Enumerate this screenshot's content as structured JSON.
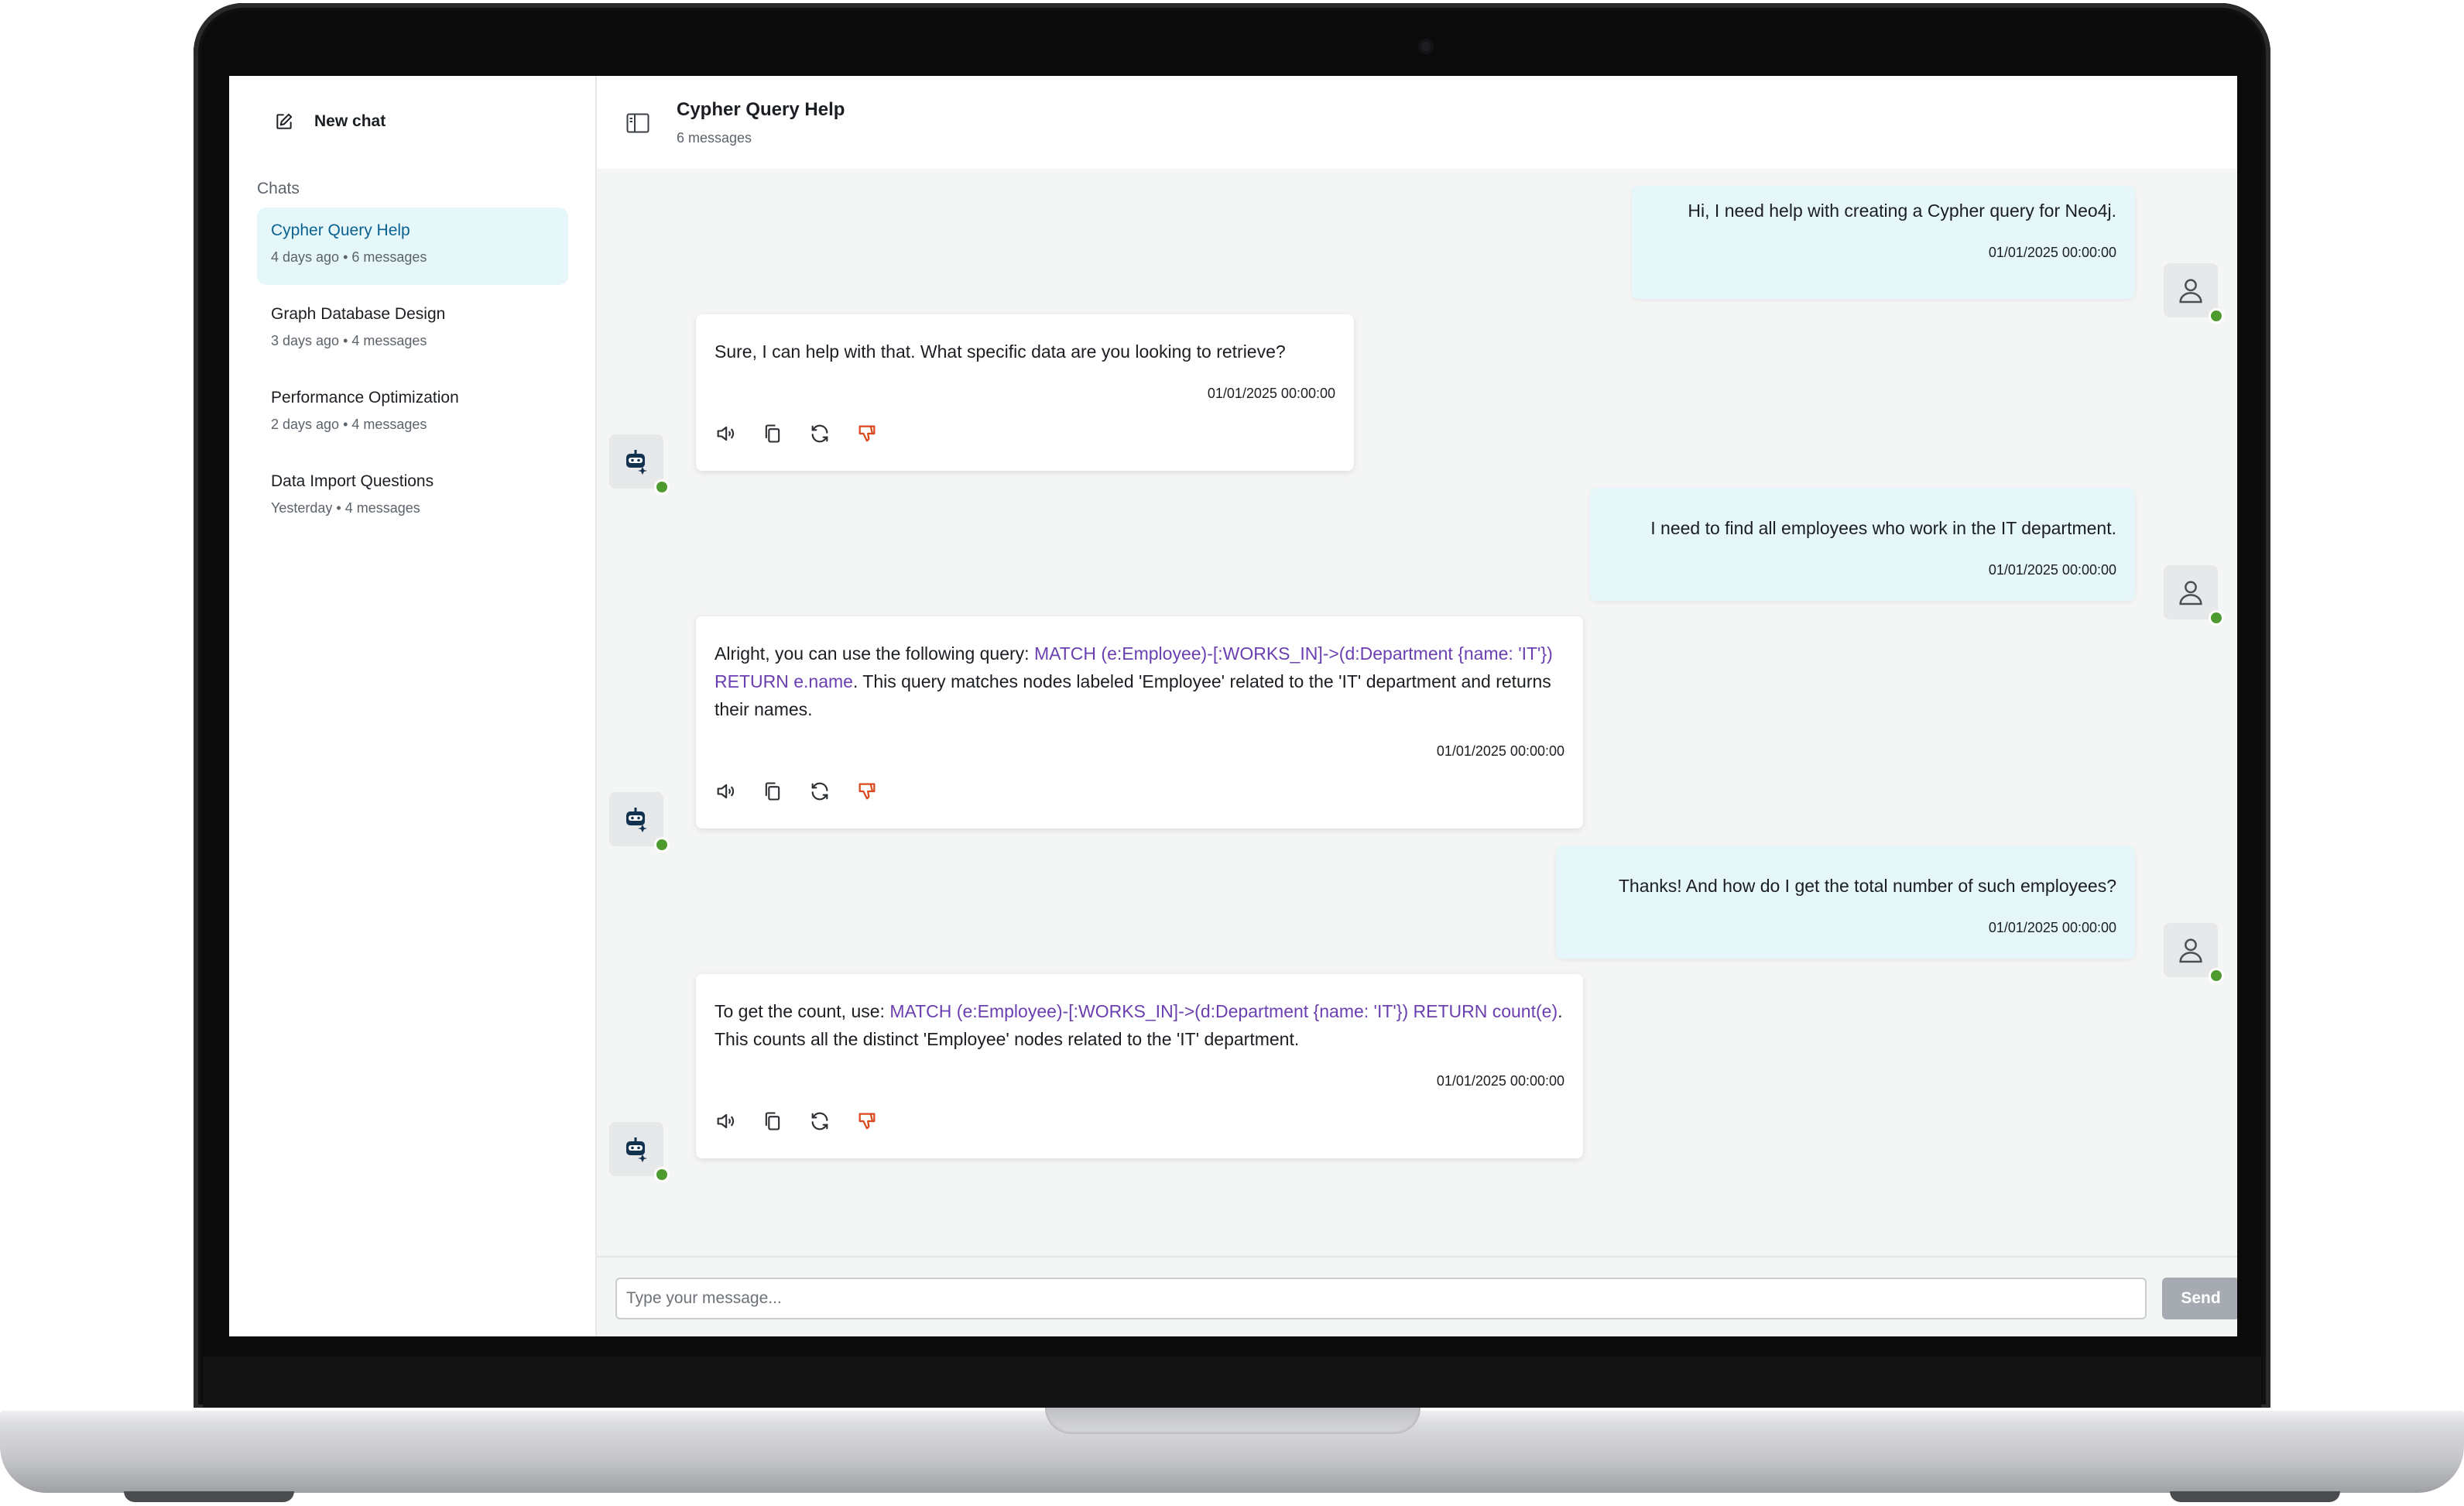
{
  "sidebar": {
    "new_chat_label": "New chat",
    "chats_heading": "Chats",
    "items": [
      {
        "title": "Cypher Query Help",
        "meta": "4 days ago • 6 messages"
      },
      {
        "title": "Graph Database Design",
        "meta": "3 days ago • 4 messages"
      },
      {
        "title": "Performance Optimization",
        "meta": "2 days ago • 4 messages"
      },
      {
        "title": "Data Import Questions",
        "meta": "Yesterday • 4 messages"
      }
    ]
  },
  "header": {
    "title": "Cypher Query Help",
    "subtitle": "6 messages"
  },
  "messages": [
    {
      "role": "user",
      "text": "Hi, I need help with creating a Cypher query for Neo4j.",
      "time": "01/01/2025 00:00:00"
    },
    {
      "role": "bot",
      "text": "Sure, I can help with that. What specific data are you looking to retrieve?",
      "time": "01/01/2025 00:00:00"
    },
    {
      "role": "user",
      "text": "I need to find all employees who work in the IT department.",
      "time": "01/01/2025 00:00:00"
    },
    {
      "role": "bot",
      "text_before": "Alright, you can use the following query: ",
      "code": "MATCH (e:Employee)-[:WORKS_IN]->(d:Department {name: 'IT'}) RETURN e.name",
      "text_after": ". This query matches nodes labeled 'Employee' related to the 'IT' department and returns their names.",
      "time": "01/01/2025 00:00:00"
    },
    {
      "role": "user",
      "text": "Thanks! And how do I get the total number of such employees?",
      "time": "01/01/2025 00:00:00"
    },
    {
      "role": "bot",
      "text_before": "To get the count, use: ",
      "code": "MATCH (e:Employee)-[:WORKS_IN]->(d:Department {name: 'IT'}) RETURN count(e)",
      "text_after": ". This counts all the distinct 'Employee' nodes related to the 'IT' department.",
      "time": "01/01/2025 00:00:00"
    }
  ],
  "input": {
    "placeholder": "Type your message...",
    "value": "",
    "send_label": "Send"
  },
  "colors": {
    "accent": "#0a6190",
    "active_chat_bg": "#e6f7fa",
    "code_text": "#6a3fb0",
    "online_dot": "#4d9a2f",
    "dislike_icon": "#d9481c"
  },
  "icons": {
    "new_chat": "edit-icon",
    "panel_toggle": "sidebar-toggle-icon",
    "speak": "speaker-icon",
    "copy": "copy-icon",
    "regenerate": "refresh-icon",
    "dislike": "thumbs-down-icon",
    "user_avatar": "user-icon",
    "bot_avatar": "robot-icon"
  }
}
